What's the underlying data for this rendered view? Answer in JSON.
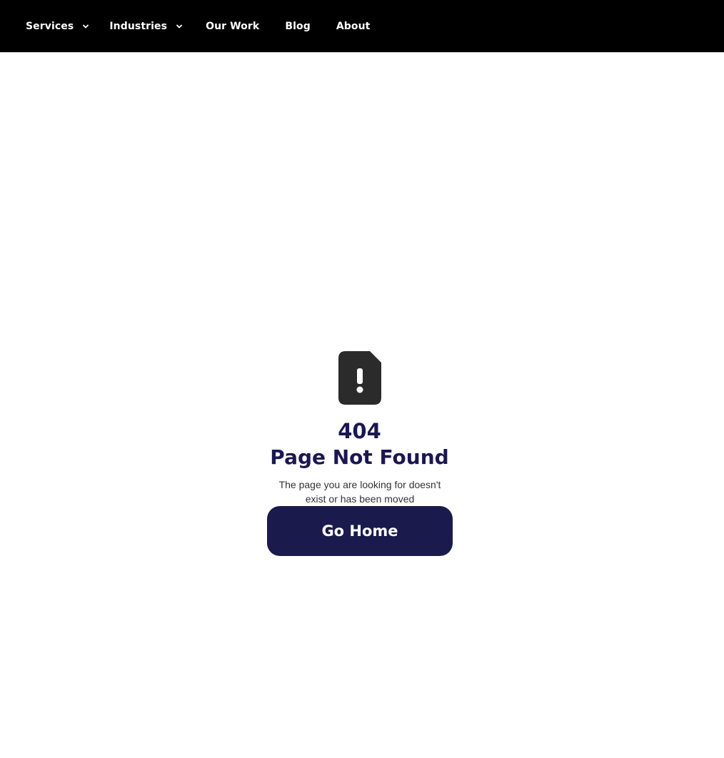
{
  "nav": {
    "items": [
      {
        "label": "Services",
        "has_dropdown": true
      },
      {
        "label": "Industries",
        "has_dropdown": true
      },
      {
        "label": "Our Work",
        "has_dropdown": false
      },
      {
        "label": "Blog",
        "has_dropdown": false
      },
      {
        "label": "About",
        "has_dropdown": false
      }
    ]
  },
  "error": {
    "icon": "file-exclamation-icon",
    "code": "404",
    "title": "Page Not Found",
    "description": "The page you are looking for doesn't exist or has been moved",
    "button_label": "Go Home"
  },
  "colors": {
    "nav_bg": "#000000",
    "nav_text": "#ffffff",
    "heading": "#1b1752",
    "button_bg": "#1b1a4c",
    "icon": "#2b2b2b"
  }
}
